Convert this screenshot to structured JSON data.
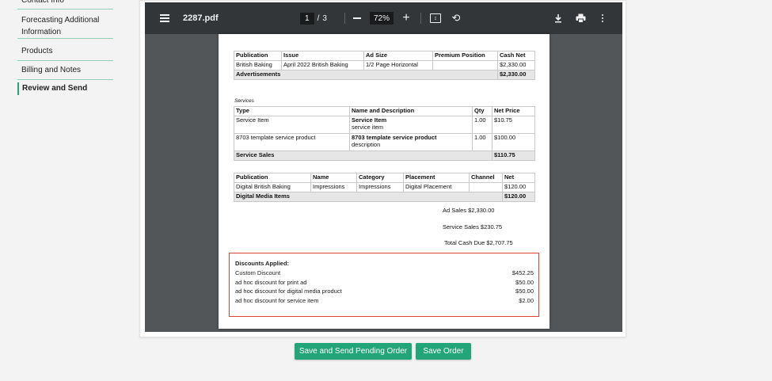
{
  "sidebar": {
    "items": [
      {
        "label": "Contact Info"
      },
      {
        "label": "Forecasting Additional Information"
      },
      {
        "label": "Products"
      },
      {
        "label": "Billing and Notes"
      },
      {
        "label": "Review and Send"
      }
    ]
  },
  "viewer": {
    "filename": "2287.pdf",
    "page_current": "1",
    "page_sep": "/",
    "page_total": "3",
    "zoom": "72%",
    "icons": [
      "menu-icon",
      "minus-icon",
      "plus-icon",
      "fit-page-icon",
      "rotate-icon",
      "download-icon",
      "print-icon",
      "more-vert-icon"
    ]
  },
  "doc": {
    "ads": {
      "headers": [
        "Publication",
        "Issue",
        "Ad Size",
        "Premium Position",
        "Cash Net"
      ],
      "rows": [
        [
          "British Baking",
          "April 2022 British Baking",
          "1/2 Page Horizontal",
          "",
          "$2,330.00"
        ]
      ],
      "total_label": "Advertisements",
      "total_value": "$2,330.00"
    },
    "services": {
      "caption": "Services",
      "headers": [
        "Type",
        "Name and Description",
        "Qty",
        "Net Price"
      ],
      "rows": [
        {
          "type": "Service Item",
          "name": "Service Item",
          "desc": "service item",
          "qty": "1.00",
          "price": "$10.75"
        },
        {
          "type": "8703 template service product",
          "name": "8703 template service product",
          "desc": "description",
          "qty": "1.00",
          "price": "$100.00"
        }
      ],
      "total_label": "Service Sales",
      "total_value": "$110.75"
    },
    "digital": {
      "headers": [
        "Publication",
        "Name",
        "Category",
        "Placement",
        "Channel",
        "Net"
      ],
      "rows": [
        [
          "Digital British Baking",
          "Impressions",
          "Impressions",
          "Digital Placement",
          "",
          "$120.00"
        ]
      ],
      "total_label": "Digital Media Items",
      "total_value": "$120.00"
    },
    "summary": {
      "ad_sales": "Ad Sales $2,330.00",
      "service_sales": "Service Sales $230.75",
      "total_cash": "Total Cash Due $2,707.75"
    },
    "discounts": {
      "title": "Discounts Applied:",
      "rows": [
        {
          "label": "Custom Discount",
          "value": "$452.25"
        },
        {
          "label": "ad hoc discount for print ad",
          "value": "$50.00"
        },
        {
          "label": "ad hoc discount for digital media product",
          "value": "$50.00"
        },
        {
          "label": "ad hoc discount for service item",
          "value": "$2.00"
        }
      ]
    }
  },
  "buttons": {
    "send_label": "Save and Send Pending Order",
    "save_label": "Save Order"
  },
  "colors": {
    "accent": "#23a57a",
    "toolbar": "#323639",
    "viewer_bg": "#525659",
    "highlight_border": "#d9433a"
  }
}
